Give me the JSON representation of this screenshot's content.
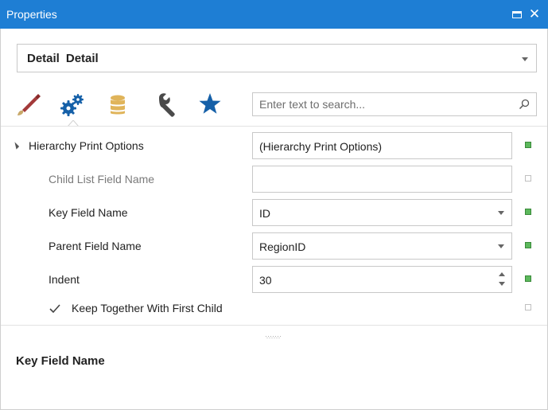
{
  "window": {
    "title": "Properties",
    "accent_color": "#1e7ed4"
  },
  "component_selector": {
    "name": "Detail",
    "type": "Detail"
  },
  "tabs": [
    {
      "icon": "brush-icon",
      "active": false
    },
    {
      "icon": "properties-gears-icon",
      "active": true
    },
    {
      "icon": "data-database-icon",
      "active": false
    },
    {
      "icon": "wrench-icon",
      "active": false
    },
    {
      "icon": "star-icon",
      "active": false
    }
  ],
  "search": {
    "placeholder": "Enter text to search...",
    "value": ""
  },
  "properties": {
    "group": {
      "label": "Hierarchy Print Options",
      "value": "(Hierarchy Print Options)",
      "expanded": true
    },
    "child_list_field": {
      "label": "Child List Field Name",
      "value": ""
    },
    "key_field": {
      "label": "Key Field Name",
      "value": "ID"
    },
    "parent_field": {
      "label": "Parent Field Name",
      "value": "RegionID"
    },
    "indent": {
      "label": "Indent",
      "value": "30"
    },
    "keep_together": {
      "label": "Keep Together With First Child",
      "checked": true
    }
  },
  "description": {
    "title": "Key Field Name"
  },
  "status_colors": {
    "modified": "#5cb85c",
    "default": "#ffffff"
  }
}
